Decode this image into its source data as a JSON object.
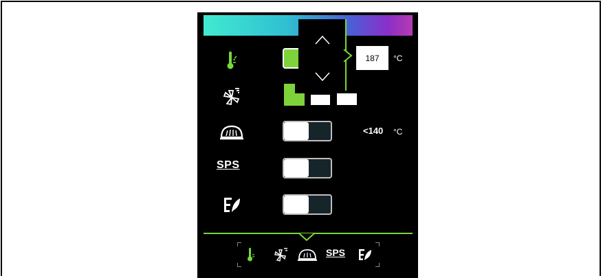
{
  "setpoint": {
    "value": "187",
    "unit": "°C"
  },
  "core_probe": {
    "value": "<140",
    "unit": "°C"
  },
  "rows": {
    "temperature": {
      "label": ""
    },
    "fan": {
      "label": ""
    },
    "keep_warm": {
      "label": ""
    },
    "sps": {
      "label": "SPS"
    },
    "eco": {
      "label": ""
    }
  },
  "bottom_nav": {
    "sps_label": "SPS"
  },
  "colors": {
    "accent": "#78d83a",
    "active_toggle": "#7ed33a",
    "panel": "#000000"
  },
  "icons": [
    "thermometer-icon",
    "fan-icon",
    "cloche-icon",
    "sps-icon",
    "eco-leaf-icon",
    "chevron-up-icon",
    "chevron-down-icon"
  ]
}
